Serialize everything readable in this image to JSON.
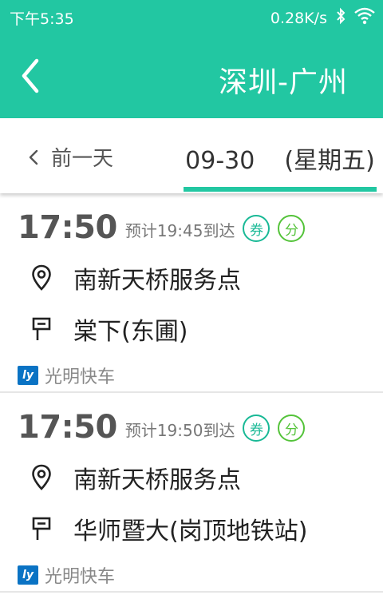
{
  "status_bar": {
    "time": "下午5:35",
    "network_speed": "0.28K/s",
    "icons": [
      "bluetooth-icon",
      "wifi-icon"
    ]
  },
  "header": {
    "title": "深圳-广州",
    "back_icon": "chevron-left-icon",
    "background_color": "#22c7a2"
  },
  "date_bar": {
    "prev_day_label": "前一天",
    "current_date": "09-30",
    "weekday": "(星期五)",
    "accent_color": "#22c7a2"
  },
  "trips": [
    {
      "depart_time": "17:50",
      "arrive_text": "预计19:45到达",
      "badge_coupon": "券",
      "badge_points": "分",
      "from_stop": "南新天桥服务点",
      "to_stop": "棠下(东圃)",
      "operator": "光明快车",
      "operator_logo_text": "ly"
    },
    {
      "depart_time": "17:50",
      "arrive_text": "预计19:50到达",
      "badge_coupon": "券",
      "badge_points": "分",
      "from_stop": "南新天桥服务点",
      "to_stop": "华师暨大(岗顶地铁站)",
      "operator": "光明快车",
      "operator_logo_text": "ly"
    }
  ]
}
